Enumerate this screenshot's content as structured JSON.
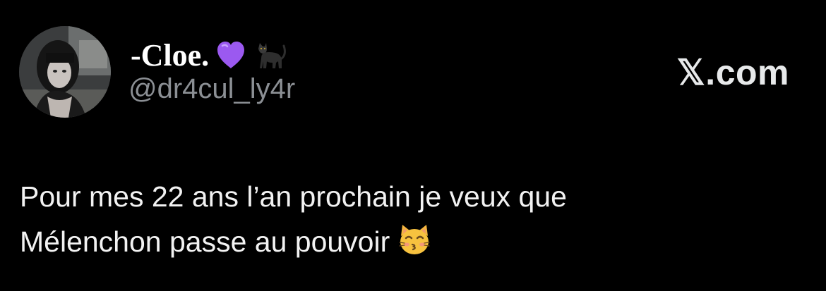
{
  "author": {
    "display_name": "-Cloe.",
    "handle": "@dr4cul_ly4r",
    "name_icons": [
      "purple-heart-icon",
      "black-cat-icon"
    ]
  },
  "brand": "𝕏.com",
  "tweet": {
    "line1": "Pour mes 22 ans l’an prochain je veux que",
    "line2": "Mélenchon passe au pouvoir",
    "emoji": "kissing-cat-icon"
  },
  "colors": {
    "background": "#000000",
    "text": "#e7e9ea",
    "secondary_text": "#8b8f94",
    "heart": "#9b59f0"
  }
}
